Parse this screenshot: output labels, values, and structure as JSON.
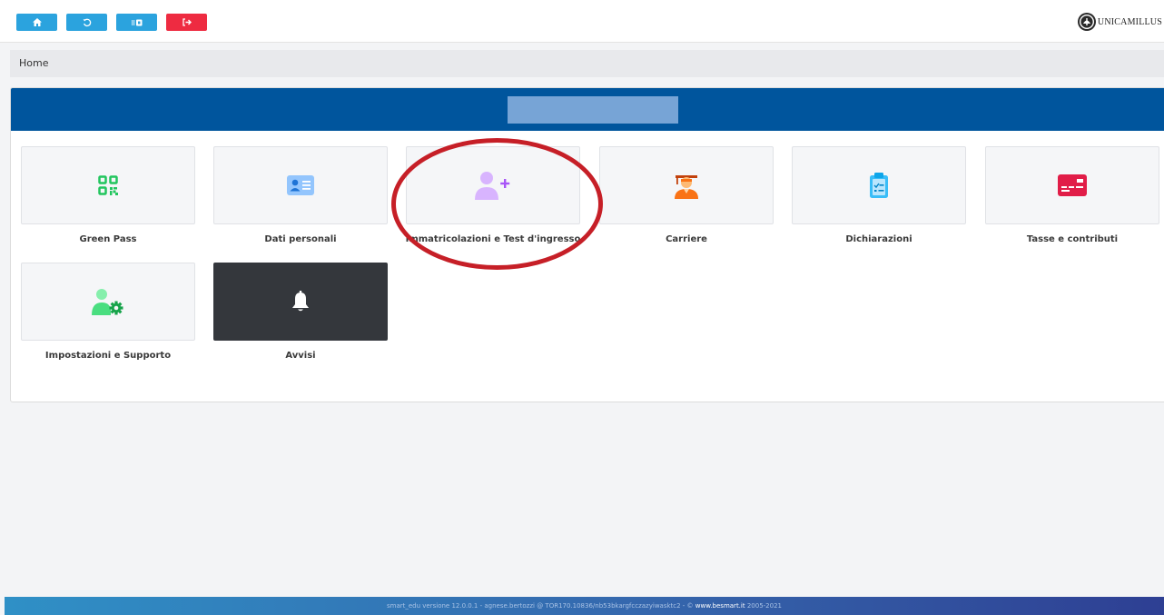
{
  "toolbar": {
    "buttons": [
      {
        "name": "home-button",
        "icon": "home-icon",
        "color": "#2ba3de"
      },
      {
        "name": "history-button",
        "icon": "history-icon",
        "color": "#2ba3de"
      },
      {
        "name": "switch-button",
        "icon": "switch-icon",
        "color": "#2ba3de"
      },
      {
        "name": "logout-button",
        "icon": "logout-icon",
        "color": "#ee2b41"
      }
    ]
  },
  "brand": {
    "name": "UNICAMILLUS"
  },
  "breadcrumb": {
    "current": "Home"
  },
  "header": {
    "color": "#00559d"
  },
  "tiles": [
    {
      "label": "Green Pass",
      "icon": "qr-code-icon",
      "color": "#22c55e"
    },
    {
      "label": "Dati personali",
      "icon": "id-card-icon",
      "color": "#60a5fa"
    },
    {
      "label": "Immatricolazioni e Test d'ingresso",
      "icon": "user-plus-icon",
      "color": "#c084fc"
    },
    {
      "label": "Carriere",
      "icon": "graduate-icon",
      "color": "#f97316"
    },
    {
      "label": "Dichiarazioni",
      "icon": "clipboard-check-icon",
      "color": "#38bdf8"
    },
    {
      "label": "Tasse e contributi",
      "icon": "credit-card-icon",
      "color": "#e11d48"
    },
    {
      "label": "Impostazioni e Supporto",
      "icon": "user-gear-icon",
      "color": "#4ade80"
    },
    {
      "label": "Avvisi",
      "icon": "bell-icon",
      "color": "#ffffff"
    }
  ],
  "annotation": {
    "color": "#c61f27"
  },
  "footer": {
    "text": "smart_edu versione 12.0.0.1 - agnese.bertozzi @ TOR170.10836/nb53bkargfcczazyiwasktc2 - ©",
    "link": "www.besmart.it",
    "years": "2005-2021"
  }
}
